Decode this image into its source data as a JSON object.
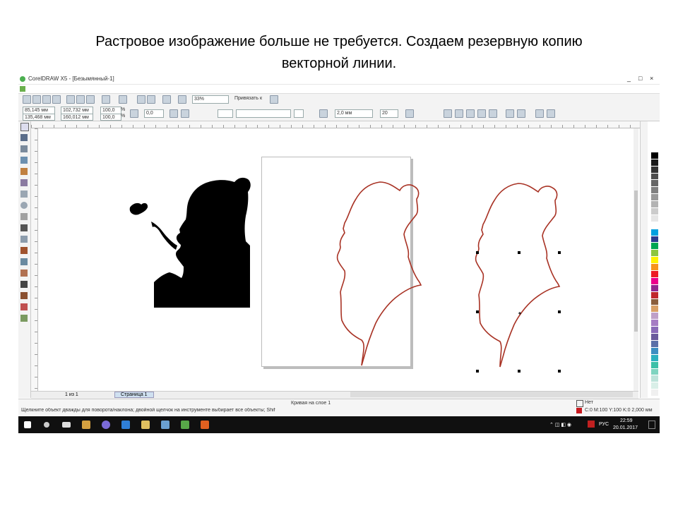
{
  "slide": {
    "title_line1": "Растровое изображение больше не требуется. Создаем резервную копию",
    "title_line2": "векторной линии."
  },
  "app": {
    "window_title": "CorelDRAW X5 - [Безымянный-1]",
    "window_controls": [
      "_",
      "□",
      "×"
    ],
    "zoom_value": "33%",
    "snap_label": "Привязать к",
    "position_x": "85,145 мм",
    "position_y": "135,468 мм",
    "width": "102,732 мм",
    "height": "160,012 мм",
    "scale_x": "100,0",
    "scale_y": "100,0",
    "percent": "%",
    "rotation": "0,0",
    "outline_width": "2,0 мм",
    "outline_value": "20"
  },
  "page_nav": {
    "counter": "1 из 1",
    "tab": "Страница 1"
  },
  "status": {
    "left": "Щелкните объект дважды для поворота/наклона; двойной щелчок на инструменте выбирает все объекты; Shift+щелчок - выбор нескольких; Alt+щелчок - выбор в глубину; Ctrl+щелчок - выбор в группе",
    "center": "Кривая на слое 1",
    "fill_label": "Нет",
    "outline_label": "C:0 M:100 Y:100 K:0  2,000 мм"
  },
  "taskbar": {
    "lang": "РУС",
    "time": "22:59",
    "date": "20.01.2017"
  },
  "colors": {
    "outline": "#a83224",
    "silhouette": "#000000",
    "taskbar": "#101010"
  },
  "palette": [
    "#ffffff",
    "#000000",
    "#1a1a1a",
    "#333333",
    "#4d4d4d",
    "#666666",
    "#808080",
    "#999999",
    "#b3b3b3",
    "#cccccc",
    "#e6e6e6",
    "#ffffff",
    "#00a0e0",
    "#2a3b8f",
    "#00a651",
    "#8dc63f",
    "#fff200",
    "#f7941d",
    "#ed1c24",
    "#ec008c",
    "#92278f",
    "#c0282d",
    "#8b5e3c",
    "#d9a066",
    "#bfa0c8",
    "#a67cc4",
    "#8a6ab8",
    "#6a5a9c",
    "#5a6fa8",
    "#3c8ec2",
    "#2bb0c0",
    "#3cc0a8",
    "#7fd4c0",
    "#bde3da",
    "#d9efe8",
    "#f0f0f0"
  ]
}
